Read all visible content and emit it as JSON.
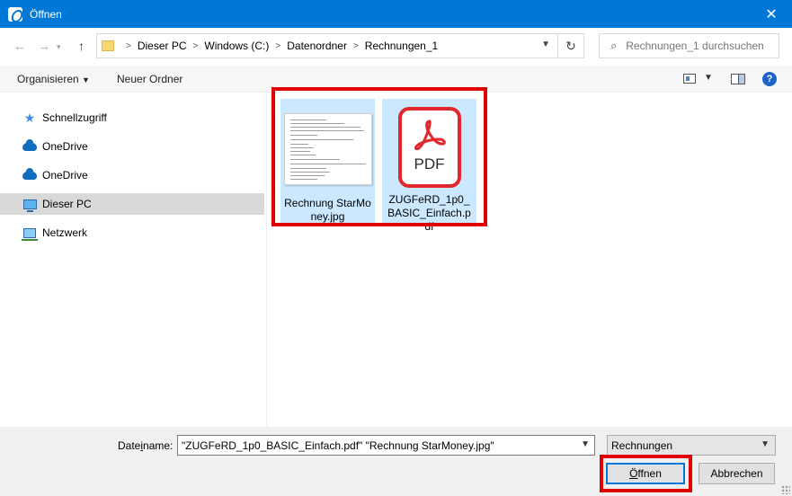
{
  "window": {
    "title": "Öffnen",
    "close_glyph": "✕"
  },
  "nav": {
    "back_glyph": "←",
    "forward_glyph": "→",
    "up_glyph": "↑"
  },
  "address": {
    "crumbs": [
      "Dieser PC",
      "Windows (C:)",
      "Datenordner",
      "Rechnungen_1"
    ],
    "separator": ">"
  },
  "search": {
    "placeholder": "Rechnungen_1 durchsuchen"
  },
  "toolbar": {
    "organize_label": "Organisieren",
    "new_folder_label": "Neuer Ordner",
    "help_label": "?"
  },
  "sidebar": {
    "items": [
      {
        "label": "Schnellzugriff",
        "icon": "star-icon"
      },
      {
        "label": "OneDrive",
        "icon": "cloud-icon"
      },
      {
        "label": "OneDrive",
        "icon": "cloud-icon"
      },
      {
        "label": "Dieser PC",
        "icon": "computer-icon",
        "selected": true
      },
      {
        "label": "Netzwerk",
        "icon": "network-icon"
      }
    ]
  },
  "files": [
    {
      "name": "Rechnung StarMoney.jpg",
      "type": "image",
      "selected": true
    },
    {
      "name": "ZUGFeRD_1p0_BASIC_Einfach.pdf",
      "type": "pdf",
      "selected": true,
      "badge": "PDF"
    }
  ],
  "footer": {
    "filename_label_pre": "Date",
    "filename_label_u": "i",
    "filename_label_post": "name:",
    "filename_value": "\"ZUGFeRD_1p0_BASIC_Einfach.pdf\" \"Rechnung StarMoney.jpg\"",
    "filetype_value": "Rechnungen",
    "open_label_u": "Ö",
    "open_label_post": "ffnen",
    "cancel_label": "Abbrechen"
  },
  "colors": {
    "accent": "#0078d7",
    "highlight": "#e00000",
    "selection": "#cce8ff"
  }
}
